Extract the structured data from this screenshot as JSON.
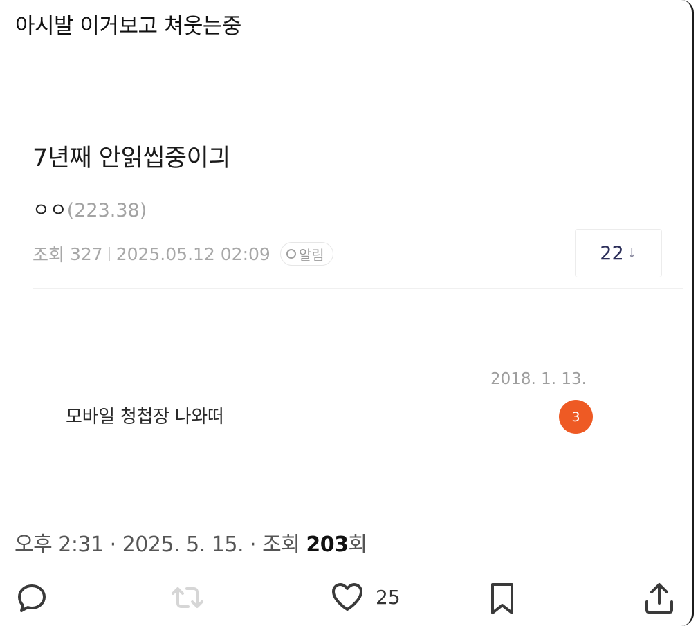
{
  "tweet": {
    "text": "아시발 이거보고 쳐웃는중",
    "time": "오후 2:31",
    "date": "2025. 5. 15.",
    "views_label": "조회",
    "views_count": "203",
    "views_suffix": "회",
    "sep": " · "
  },
  "post": {
    "title": "7년째 안읽씹중이긔",
    "author": "ㅇㅇ",
    "author_ip": "(223.38)",
    "views_label": "조회",
    "views": "327",
    "datetime": "2025.05.12 02:09",
    "alarm_label": "알림",
    "comment_count": "22",
    "comment_arrow": "↓"
  },
  "embed": {
    "date": "2018. 1. 13.",
    "message": "모바일 청첩장 나와떠",
    "unread_badge": "3"
  },
  "actions": {
    "like_count": "25",
    "icons": [
      "reply-icon",
      "retweet-icon",
      "heart-icon",
      "bookmark-icon",
      "share-icon"
    ]
  },
  "colors": {
    "badge": "#ee5a24",
    "comment_count": "#2c2f5a",
    "muted": "#a7a7a7"
  }
}
